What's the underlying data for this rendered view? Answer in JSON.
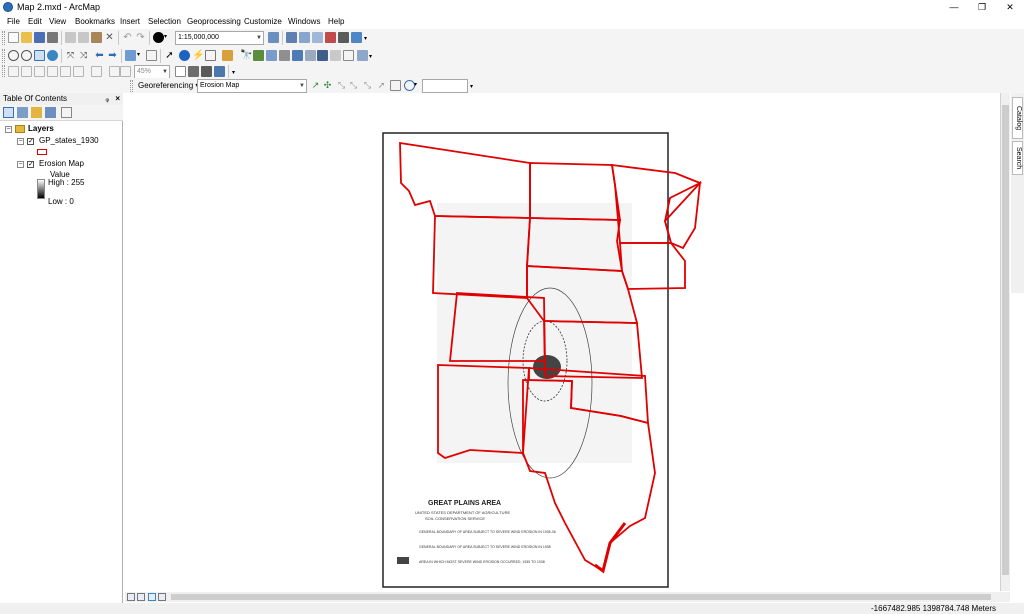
{
  "window": {
    "title": "Map 2.mxd - ArcMap",
    "minimize": "—",
    "restore": "❐",
    "close": "✕"
  },
  "menu": [
    "File",
    "Edit",
    "View",
    "Bookmarks",
    "Insert",
    "Selection",
    "Geoprocessing",
    "Customize",
    "Windows",
    "Help"
  ],
  "standard_toolbar": {
    "scale_value": "1:15,000,000"
  },
  "layout_toolbar": {
    "zoom_percent": "45%"
  },
  "georef_toolbar": {
    "label": "Georeferencing ▾",
    "layer_value": "Erosion Map"
  },
  "toc": {
    "title": "Table Of Contents",
    "pin": "ᵩ",
    "close": "×",
    "root_label": "Layers",
    "layer1": "GP_states_1930",
    "layer2": "Erosion Map",
    "value_label": "Value",
    "high_label": "High : 255",
    "low_label": "Low : 0"
  },
  "dock": {
    "catalog": "Catalog",
    "search": "Search"
  },
  "map": {
    "title": "GREAT PLAINS AREA",
    "subtitle1": "UNITED STATES DEPARTMENT OF AGRICULTURE",
    "subtitle2": "SOIL CONSERVATION SERVICE",
    "legend1": "GENERAL BOUNDARY OF AREA SUBJECT TO SEVERE WIND EROSION IN 1935-36",
    "legend2": "GENERAL BOUNDARY OF AREA SUBJECT TO SEVERE WIND EROSION IN 1938",
    "legend3": "AREA IN WHICH MOST SEVERE WIND EROSION OCCURRED, 1935 TO 1938"
  },
  "status": {
    "coordinates": "-1667482.985  1398784.748 Meters"
  },
  "colors": {
    "state_outline": "#e00000",
    "toolbar_bg": "#f4f4f4"
  }
}
